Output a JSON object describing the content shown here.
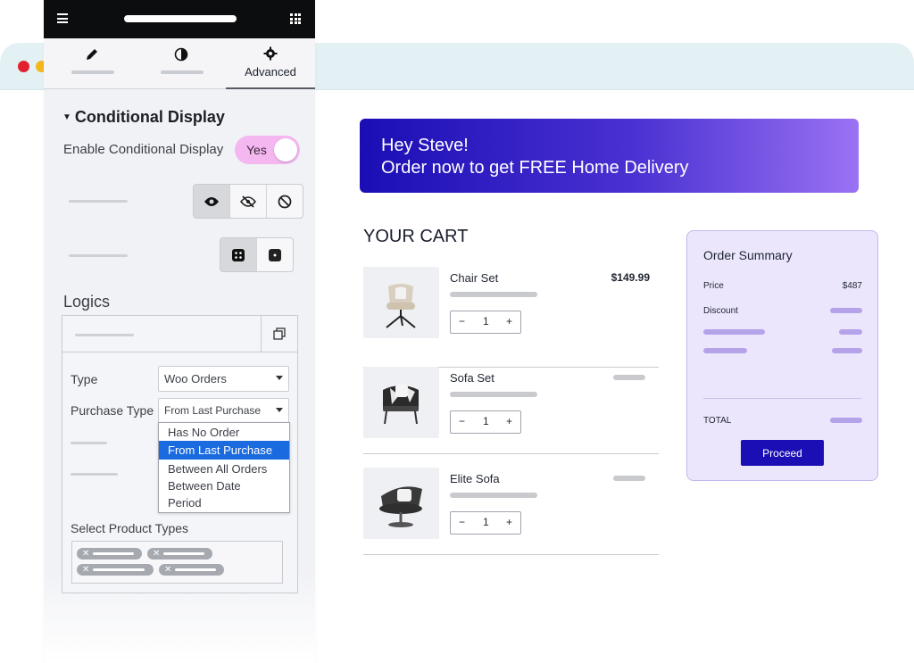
{
  "editor": {
    "tabs": [
      {
        "icon": "pencil-icon",
        "label": ""
      },
      {
        "icon": "contrast-icon",
        "label": ""
      },
      {
        "icon": "gear-icon",
        "label": "Advanced"
      }
    ],
    "section_title": "Conditional Display",
    "enable_label": "Enable Conditional Display",
    "toggle": {
      "label": "Yes",
      "on": true
    },
    "logics_title": "Logics",
    "type_label": "Type",
    "type_value": "Woo Orders",
    "purchase_type_label": "Purchase Type",
    "purchase_type_value": "From Last Purchase",
    "purchase_type_options": [
      "Has No Order",
      "From Last Purchase",
      "Between All Orders",
      "Between Date",
      "Period"
    ],
    "product_types_label": "Select Product Types"
  },
  "banner": {
    "line1": "Hey Steve!",
    "line2": "Order now to get FREE Home Delivery"
  },
  "cart": {
    "title": "YOUR CART",
    "items": [
      {
        "name": "Chair Set",
        "price": "$149.99",
        "qty": "1"
      },
      {
        "name": "Sofa Set",
        "price": "",
        "qty": "1"
      },
      {
        "name": "Elite Sofa",
        "price": "",
        "qty": "1"
      }
    ],
    "minus": "−",
    "plus": "+"
  },
  "summary": {
    "title": "Order Summary",
    "price_label": "Price",
    "price_value": "$487",
    "discount_label": "Discount",
    "total_label": "TOTAL",
    "proceed_label": "Proceed"
  },
  "colors": {
    "banner_start": "#1a0eb4",
    "banner_end": "#9a72f3",
    "toggle_on": "#f4b7f0",
    "summary_bg": "#ece6fd",
    "proceed": "#1a0eb4",
    "dropdown_selected": "#1a6be0"
  }
}
